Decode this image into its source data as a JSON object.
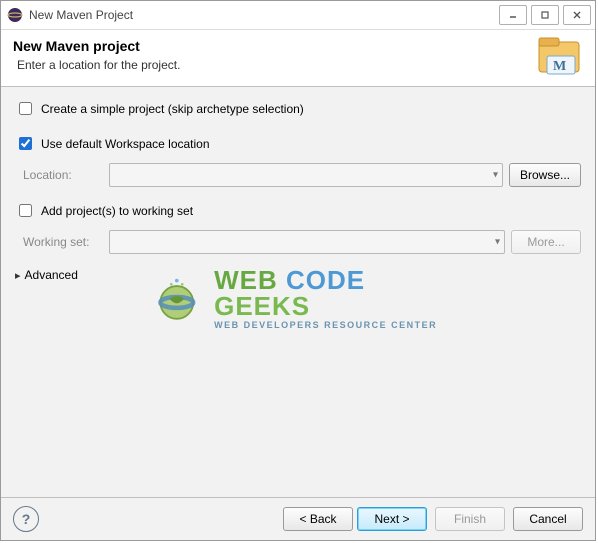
{
  "window": {
    "title": "New Maven Project"
  },
  "header": {
    "title": "New Maven project",
    "subtitle": "Enter a location for the project."
  },
  "options": {
    "simple_project": {
      "label": "Create a simple project (skip archetype selection)",
      "checked": false
    },
    "use_default_loc": {
      "label": "Use default Workspace location",
      "checked": true
    },
    "location_label": "Location:",
    "browse_label": "Browse...",
    "add_to_ws": {
      "label": "Add project(s) to working set",
      "checked": false
    },
    "working_set_label": "Working set:",
    "more_label": "More...",
    "advanced_label": "Advanced"
  },
  "watermark": {
    "word1": "WEB",
    "word2": "CODE",
    "word3": "GEEKS",
    "sub": "WEB DEVELOPERS RESOURCE CENTER"
  },
  "footer": {
    "back": "< Back",
    "next": "Next >",
    "finish": "Finish",
    "cancel": "Cancel"
  }
}
